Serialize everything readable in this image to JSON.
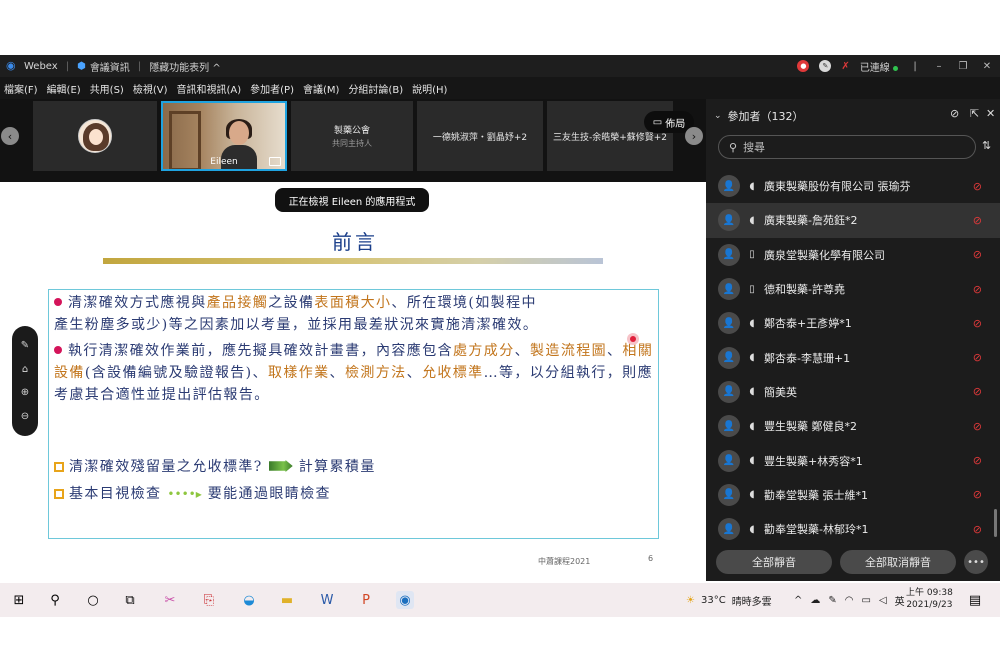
{
  "titlebar": {
    "app_name": "Webex",
    "meeting_info": "會議資訊",
    "hidden_features": "隱藏功能表列 ^",
    "connection_status": "已連線"
  },
  "menubar": [
    "檔案(F)",
    "編輯(E)",
    "共用(S)",
    "檢視(V)",
    "音訊和視訊(A)",
    "參加者(P)",
    "會議(M)",
    "分組討論(B)",
    "說明(H)"
  ],
  "video_strip": {
    "tile_eileen_name": "Eileen",
    "tile_host_name": "製藥公會",
    "tile_host_role": "共同主持人",
    "tile_4_name": "一德姚淑萍・劉晶妤+2",
    "tile_5_name": "三友生技-余皓榮+蘇修賢+2",
    "layout_label": "佈局"
  },
  "share": {
    "viewing_label": "正在檢視 Eileen 的應用程式"
  },
  "slide": {
    "title": "前言",
    "bullet1_a": "清潔確效方式應視與",
    "bullet1_b": "產品接觸",
    "bullet1_c": "之設備",
    "bullet1_d": "表面積大小",
    "bullet1_e": "、所在環境(如製程中",
    "bullet1_line2": "產生粉塵多或少)等之因素加以考量，並採用最差狀況來實施清潔確效。",
    "bullet2_a": "執行清潔確效作業前，應先擬具確效計畫書，內容應包含",
    "bullet2_b": "處方成分",
    "bullet2_c": "、",
    "bullet2_d": "製造流程圖",
    "bullet2_e": "、",
    "bullet2_f": "相關設備",
    "bullet2_g": "(含設備編號及驗證報告)、",
    "bullet2_h": "取樣作業",
    "bullet2_i": "、",
    "bullet2_j": "檢測方",
    "bullet2_k": "法",
    "bullet2_l": "、",
    "bullet2_m": "允收標準",
    "bullet2_n": "…等，以分組執行，則應考慮其合適性並提出評估報",
    "bullet2_line4": "告。",
    "item1_q": "清潔確效殘留量之允收標準?",
    "item1_a": "計算累積量",
    "item2_q": "基本目視檢查",
    "item2_a": "要能通過眼睛檢查",
    "footer_left": "中蕭課程2021",
    "footer_page": "6"
  },
  "participants": {
    "header": "參加者（132）",
    "search_placeholder": "搜尋",
    "list": [
      {
        "name": "廣東製藥股份有限公司 張瑜芬",
        "device": "headset"
      },
      {
        "name": "廣東製藥-詹苑鈺*2",
        "device": "headset"
      },
      {
        "name": "廣泉堂製藥化學有限公司",
        "device": "phone"
      },
      {
        "name": "德和製藥-許尊堯",
        "device": "phone"
      },
      {
        "name": "鄭杏泰+王彥婷*1",
        "device": "headset"
      },
      {
        "name": "鄭杏泰-李慧珊+1",
        "device": "headset"
      },
      {
        "name": "簡美英",
        "device": "headset"
      },
      {
        "name": "豐生製藥 鄭健良*2",
        "device": "headset"
      },
      {
        "name": "豐生製藥+林秀容*1",
        "device": "headset"
      },
      {
        "name": "勸奉堂製藥 張士維*1",
        "device": "headset"
      },
      {
        "name": "勸奉堂製藥-林郁玲*1",
        "device": "headset"
      }
    ],
    "mute_all": "全部靜音",
    "unmute_all": "全部取消靜音"
  },
  "taskbar": {
    "weather_temp": "33°C",
    "weather_desc": "晴時多雲",
    "ime": "英",
    "time": "上午 09:38",
    "date": "2021/9/23"
  },
  "colors": {
    "accent_blue": "#1fa3e0",
    "mute_red": "#e0393a",
    "slide_text": "#2b3b73",
    "slide_highlight": "#c2751c",
    "bullet": "#d4145a"
  }
}
